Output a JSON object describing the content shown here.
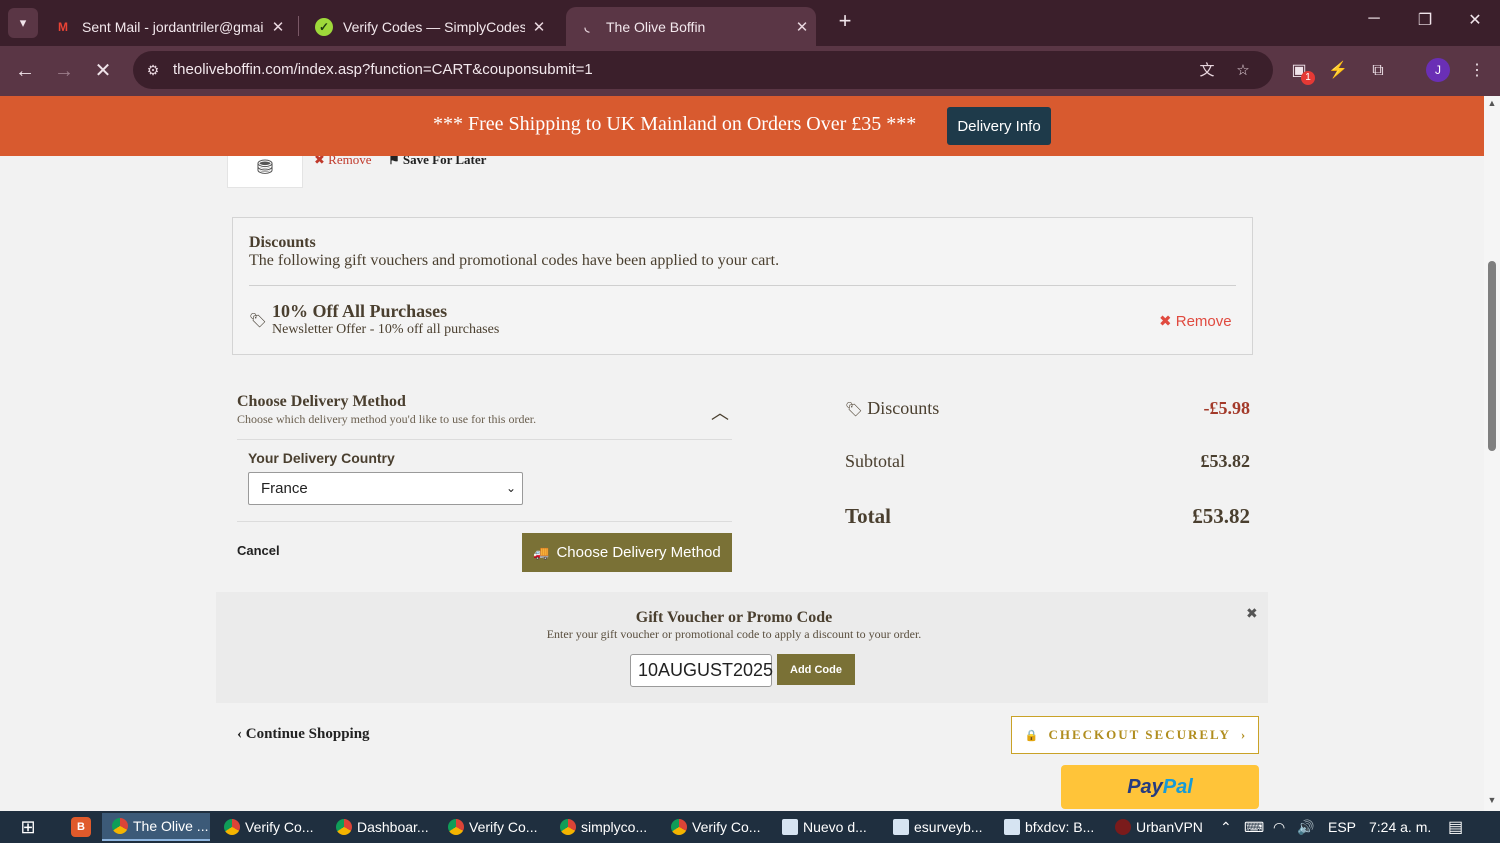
{
  "browser": {
    "tabs": [
      {
        "title": "Sent Mail - jordantriler@gmail.c",
        "icon": "gmail-icon"
      },
      {
        "title": "Verify Codes — SimplyCodes",
        "icon": "simplycodes-icon"
      },
      {
        "title": "The Olive Boffin",
        "icon": "loading-icon"
      }
    ],
    "url": "theoliveboffin.com/index.asp?function=CART&couponsubmit=1",
    "extension_badge": "1",
    "profile_initial": "J"
  },
  "banner": {
    "text": "*** Free Shipping to UK Mainland on Orders Over £35 ***",
    "button": "Delivery Info",
    "color": "#d85a2f"
  },
  "cart_item": {
    "remove": "Remove",
    "save_for_later": "Save For Later"
  },
  "discounts": {
    "heading": "Discounts",
    "description": "The following gift vouchers and promotional codes have been applied to your cart.",
    "promo_title": "10% Off All Purchases",
    "promo_subtitle": "Newsletter Offer - 10% off all purchases",
    "remove": "Remove"
  },
  "delivery": {
    "title": "Choose Delivery Method",
    "subtitle": "Choose which delivery method you'd like to use for this order.",
    "country_label": "Your Delivery Country",
    "country": "France",
    "cancel": "Cancel",
    "choose_button": "Choose Delivery Method"
  },
  "summary": {
    "discounts_label": "Discounts",
    "discounts_value": "-£5.98",
    "subtotal_label": "Subtotal",
    "subtotal_value": "£53.82",
    "total_label": "Total",
    "total_value": "£53.82"
  },
  "voucher": {
    "title": "Gift Voucher or Promo Code",
    "subtitle": "Enter your gift voucher or promotional code to apply a discount to your order.",
    "code": "10AUGUST2025",
    "add_button": "Add Code"
  },
  "footer_actions": {
    "continue": "Continue Shopping",
    "checkout": "CHECKOUT SECURELY",
    "paypal_pay": "Pay",
    "paypal_pal": "Pal"
  },
  "taskbar": {
    "items": [
      {
        "label": "The Olive ...",
        "icon": "chrome"
      },
      {
        "label": "Verify Co...",
        "icon": "chrome"
      },
      {
        "label": "Dashboar...",
        "icon": "chrome"
      },
      {
        "label": "Verify Co...",
        "icon": "chrome"
      },
      {
        "label": "simplyco...",
        "icon": "chrome"
      },
      {
        "label": "Verify Co...",
        "icon": "chrome"
      },
      {
        "label": "Nuevo d...",
        "icon": "doc"
      },
      {
        "label": "esurveyb...",
        "icon": "doc"
      },
      {
        "label": "bfxdcv: B...",
        "icon": "doc"
      },
      {
        "label": "UrbanVPN",
        "icon": "vpn"
      }
    ],
    "language": "ESP",
    "time": "7:24 a. m."
  }
}
